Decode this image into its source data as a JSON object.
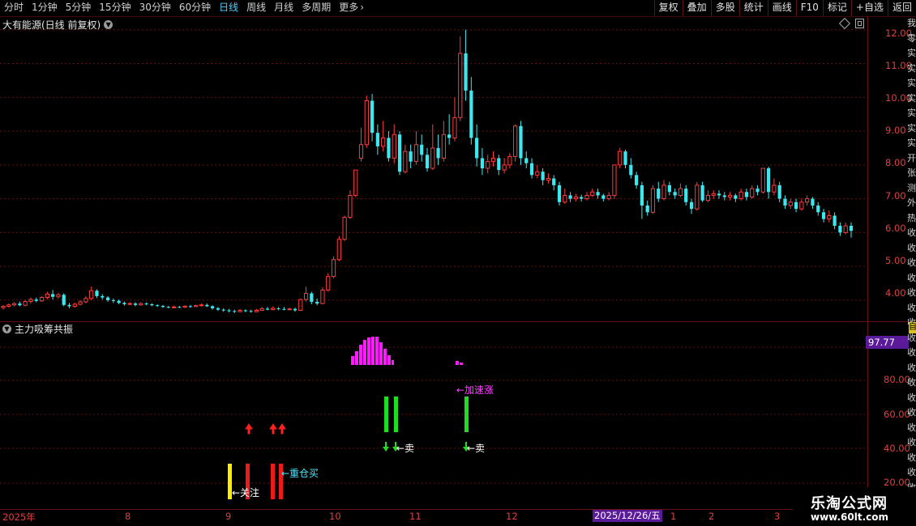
{
  "toolbar": {
    "periods": [
      "分时",
      "1分钟",
      "5分钟",
      "15分钟",
      "30分钟",
      "60分钟",
      "日线",
      "周线",
      "月线",
      "多周期",
      "更多"
    ],
    "active_period": "日线",
    "more_arrow": "›",
    "tools": [
      "复权",
      "叠加",
      "多股",
      "统计",
      "画线",
      "F10",
      "标记",
      "+自选",
      "返回"
    ]
  },
  "main_chart": {
    "title": "大有能源(日线 前复权)",
    "y_ticks": [
      "12.00",
      "11.00",
      "10.00",
      "9.00",
      "8.00",
      "7.00",
      "6.00",
      "5.00",
      "4.00"
    ]
  },
  "indicator": {
    "name": "主力吸筹共振",
    "value_badge": "97.77",
    "y_ticks": [
      "80.00",
      "60.00",
      "40.00",
      "20.00"
    ],
    "labels": {
      "watch": "←关注",
      "heavy_buy": "←重仓买",
      "sell1": "←卖",
      "sell2": "←卖",
      "accel": "←加速涨"
    }
  },
  "x_axis": {
    "labels": [
      "2025年",
      "8",
      "9",
      "10",
      "11",
      "12",
      "1",
      "2",
      "3"
    ],
    "cursor_date": "2025/12/26/五"
  },
  "right_strip": {
    "chars": [
      "我",
      "零",
      "实",
      "实",
      "实",
      "实",
      "实",
      "实",
      "实",
      "开",
      "张",
      "测",
      "外",
      "热",
      "收",
      "收",
      "收",
      "收",
      "收",
      "收",
      "收",
      "收",
      "收",
      "收",
      "收",
      "收",
      "收",
      "收",
      "收",
      "收",
      "收",
      "收"
    ],
    "badge": "自"
  },
  "watermark": {
    "line1": "乐淘公式网",
    "line2": "www.60lt.com"
  },
  "colors": {
    "up": "#ff3c3c",
    "down": "#3ce8f0",
    "grid": "#6a1010",
    "axis": "#e04040",
    "magenta": "#ff1aff",
    "green": "#20dd20",
    "yellow": "#ffee00"
  },
  "chart_data": {
    "type": "candlestick",
    "y_range": [
      3.4,
      12.4
    ],
    "indicator_y_range": [
      0,
      100
    ],
    "candles": [
      [
        3.78,
        3.82,
        3.72,
        3.85
      ],
      [
        3.82,
        3.86,
        3.78,
        3.9
      ],
      [
        3.86,
        3.9,
        3.82,
        3.94
      ],
      [
        3.9,
        3.85,
        3.82,
        3.96
      ],
      [
        3.85,
        3.96,
        3.82,
        4.0
      ],
      [
        3.96,
        4.02,
        3.9,
        4.08
      ],
      [
        4.02,
        3.98,
        3.94,
        4.08
      ],
      [
        3.98,
        4.08,
        3.95,
        4.12
      ],
      [
        4.08,
        4.18,
        4.02,
        4.25
      ],
      [
        4.18,
        4.1,
        4.02,
        4.3
      ],
      [
        4.1,
        4.16,
        4.05,
        4.22
      ],
      [
        4.16,
        3.86,
        3.82,
        4.2
      ],
      [
        3.86,
        3.82,
        3.76,
        3.92
      ],
      [
        3.82,
        3.88,
        3.78,
        3.93
      ],
      [
        3.88,
        3.95,
        3.84,
        4.0
      ],
      [
        3.95,
        4.05,
        3.9,
        4.12
      ],
      [
        4.05,
        4.28,
        4.0,
        4.4
      ],
      [
        4.28,
        4.12,
        4.06,
        4.32
      ],
      [
        4.12,
        4.08,
        4.02,
        4.18
      ],
      [
        4.08,
        4.0,
        3.95,
        4.12
      ],
      [
        4.0,
        3.98,
        3.92,
        4.05
      ],
      [
        3.98,
        3.92,
        3.88,
        4.02
      ],
      [
        3.92,
        3.88,
        3.84,
        3.96
      ],
      [
        3.88,
        3.9,
        3.85,
        3.94
      ],
      [
        3.9,
        3.86,
        3.82,
        3.94
      ],
      [
        3.86,
        3.9,
        3.84,
        3.94
      ],
      [
        3.9,
        3.88,
        3.85,
        3.93
      ],
      [
        3.88,
        3.85,
        3.82,
        3.91
      ],
      [
        3.85,
        3.83,
        3.8,
        3.88
      ],
      [
        3.83,
        3.8,
        3.77,
        3.86
      ],
      [
        3.8,
        3.78,
        3.76,
        3.83
      ],
      [
        3.78,
        3.8,
        3.76,
        3.84
      ],
      [
        3.8,
        3.79,
        3.77,
        3.83
      ],
      [
        3.79,
        3.82,
        3.77,
        3.85
      ],
      [
        3.82,
        3.81,
        3.78,
        3.86
      ],
      [
        3.81,
        3.84,
        3.8,
        3.87
      ],
      [
        3.84,
        3.86,
        3.82,
        3.9
      ],
      [
        3.86,
        3.82,
        3.8,
        3.9
      ],
      [
        3.82,
        3.76,
        3.72,
        3.85
      ],
      [
        3.76,
        3.72,
        3.68,
        3.8
      ],
      [
        3.72,
        3.7,
        3.66,
        3.76
      ],
      [
        3.7,
        3.68,
        3.64,
        3.74
      ],
      [
        3.68,
        3.66,
        3.62,
        3.72
      ],
      [
        3.66,
        3.7,
        3.64,
        3.74
      ],
      [
        3.7,
        3.68,
        3.64,
        3.73
      ],
      [
        3.68,
        3.66,
        3.63,
        3.72
      ],
      [
        3.66,
        3.7,
        3.64,
        3.74
      ],
      [
        3.7,
        3.75,
        3.68,
        3.8
      ],
      [
        3.75,
        3.72,
        3.7,
        3.8
      ],
      [
        3.72,
        3.76,
        3.7,
        3.82
      ],
      [
        3.76,
        3.74,
        3.7,
        3.8
      ],
      [
        3.74,
        3.72,
        3.7,
        3.8
      ],
      [
        3.72,
        3.74,
        3.7,
        3.78
      ],
      [
        3.74,
        3.7,
        3.66,
        3.78
      ],
      [
        3.7,
        4.02,
        3.68,
        4.05
      ],
      [
        4.02,
        4.2,
        3.96,
        4.4
      ],
      [
        4.2,
        3.95,
        3.88,
        4.25
      ],
      [
        3.95,
        3.9,
        3.85,
        4.05
      ],
      [
        3.9,
        4.3,
        3.88,
        4.38
      ],
      [
        4.3,
        4.7,
        4.25,
        4.8
      ],
      [
        4.7,
        5.2,
        4.65,
        5.3
      ],
      [
        5.2,
        5.8,
        5.15,
        5.9
      ],
      [
        5.8,
        6.45,
        5.75,
        6.5
      ],
      [
        6.45,
        7.1,
        6.4,
        7.25
      ],
      [
        7.1,
        7.85,
        7.05,
        7.85
      ],
      [
        8.2,
        8.6,
        8.1,
        9.1
      ],
      [
        8.6,
        9.9,
        8.5,
        10.05
      ],
      [
        9.9,
        8.95,
        8.7,
        10.1
      ],
      [
        8.95,
        8.55,
        8.3,
        9.2
      ],
      [
        8.55,
        8.8,
        8.4,
        9.3
      ],
      [
        8.8,
        8.2,
        8.1,
        9.0
      ],
      [
        8.2,
        8.9,
        8.05,
        9.2
      ],
      [
        8.9,
        7.8,
        7.7,
        9.0
      ],
      [
        7.8,
        8.4,
        7.75,
        8.6
      ],
      [
        8.4,
        8.1,
        7.9,
        8.6
      ],
      [
        8.1,
        8.6,
        8.0,
        9.0
      ],
      [
        8.6,
        8.3,
        8.1,
        8.9
      ],
      [
        8.3,
        7.9,
        7.8,
        8.5
      ],
      [
        7.9,
        8.5,
        7.85,
        9.2
      ],
      [
        8.5,
        8.2,
        8.0,
        8.9
      ],
      [
        8.2,
        8.9,
        8.1,
        9.3
      ],
      [
        8.9,
        8.8,
        8.6,
        9.5
      ],
      [
        8.8,
        9.4,
        8.7,
        10.0
      ],
      [
        9.4,
        11.3,
        9.3,
        11.8
      ],
      [
        11.3,
        10.2,
        9.9,
        12.0
      ],
      [
        10.2,
        8.8,
        8.6,
        10.6
      ],
      [
        8.8,
        8.2,
        7.95,
        9.2
      ],
      [
        8.2,
        7.9,
        7.7,
        8.5
      ],
      [
        7.9,
        8.1,
        7.75,
        8.3
      ],
      [
        8.1,
        8.2,
        7.95,
        8.4
      ],
      [
        8.2,
        7.85,
        7.7,
        8.3
      ],
      [
        7.85,
        8.0,
        7.75,
        8.2
      ],
      [
        8.0,
        8.25,
        7.9,
        8.35
      ],
      [
        8.25,
        9.15,
        8.1,
        9.2
      ],
      [
        9.15,
        8.2,
        8.0,
        9.3
      ],
      [
        8.2,
        8.05,
        7.9,
        8.4
      ],
      [
        8.05,
        7.7,
        7.6,
        8.2
      ],
      [
        7.7,
        7.8,
        7.6,
        8.0
      ],
      [
        7.8,
        7.55,
        7.4,
        7.9
      ],
      [
        7.55,
        7.6,
        7.45,
        7.75
      ],
      [
        7.6,
        7.4,
        7.25,
        7.7
      ],
      [
        7.4,
        6.9,
        6.8,
        7.5
      ],
      [
        6.9,
        7.1,
        6.85,
        7.3
      ],
      [
        7.1,
        7.0,
        6.9,
        7.2
      ],
      [
        7.0,
        7.05,
        6.92,
        7.15
      ],
      [
        7.05,
        7.0,
        6.92,
        7.12
      ],
      [
        7.0,
        7.1,
        6.95,
        7.2
      ],
      [
        7.1,
        7.2,
        7.05,
        7.3
      ],
      [
        7.2,
        7.1,
        7.0,
        7.3
      ],
      [
        7.1,
        7.0,
        6.92,
        7.15
      ],
      [
        7.0,
        7.1,
        6.95,
        7.2
      ],
      [
        7.1,
        8.0,
        7.0,
        8.0
      ],
      [
        8.0,
        8.4,
        7.9,
        8.5
      ],
      [
        8.4,
        8.0,
        7.9,
        8.45
      ],
      [
        8.0,
        7.7,
        7.6,
        8.2
      ],
      [
        7.7,
        7.4,
        7.3,
        7.8
      ],
      [
        7.4,
        6.8,
        6.4,
        7.5
      ],
      [
        6.8,
        6.6,
        6.5,
        6.95
      ],
      [
        6.6,
        7.3,
        6.55,
        7.4
      ],
      [
        7.3,
        7.0,
        6.9,
        7.5
      ],
      [
        7.0,
        7.4,
        6.95,
        7.55
      ],
      [
        7.4,
        7.2,
        7.1,
        7.5
      ],
      [
        7.2,
        7.1,
        7.0,
        7.3
      ],
      [
        7.1,
        7.3,
        7.05,
        7.45
      ],
      [
        7.3,
        6.9,
        6.8,
        7.4
      ],
      [
        6.9,
        6.7,
        6.55,
        7.0
      ],
      [
        6.7,
        7.4,
        6.65,
        7.5
      ],
      [
        7.4,
        6.95,
        6.9,
        7.5
      ],
      [
        6.95,
        7.1,
        6.9,
        7.25
      ],
      [
        7.1,
        7.15,
        7.0,
        7.25
      ],
      [
        7.15,
        7.1,
        7.0,
        7.25
      ],
      [
        7.1,
        7.05,
        6.95,
        7.2
      ],
      [
        7.05,
        7.1,
        6.95,
        7.2
      ],
      [
        7.1,
        7.0,
        6.9,
        7.15
      ],
      [
        7.0,
        7.2,
        6.95,
        7.3
      ],
      [
        7.2,
        7.05,
        6.95,
        7.3
      ],
      [
        7.05,
        7.3,
        7.0,
        7.4
      ],
      [
        7.3,
        7.2,
        7.1,
        7.4
      ],
      [
        7.2,
        7.9,
        7.15,
        7.9
      ],
      [
        7.9,
        7.2,
        7.0,
        7.95
      ],
      [
        7.2,
        7.4,
        7.1,
        7.6
      ],
      [
        7.4,
        7.0,
        6.9,
        7.5
      ],
      [
        7.0,
        6.8,
        6.7,
        7.1
      ],
      [
        6.8,
        6.9,
        6.7,
        7.0
      ],
      [
        6.9,
        6.7,
        6.6,
        7.0
      ],
      [
        6.7,
        6.9,
        6.65,
        7.0
      ],
      [
        6.9,
        7.0,
        6.8,
        7.1
      ],
      [
        7.0,
        6.8,
        6.7,
        7.05
      ],
      [
        6.8,
        6.6,
        6.5,
        6.9
      ],
      [
        6.6,
        6.4,
        6.3,
        6.7
      ],
      [
        6.4,
        6.5,
        6.3,
        6.65
      ],
      [
        6.5,
        6.2,
        6.1,
        6.6
      ],
      [
        6.2,
        6.0,
        5.9,
        6.3
      ],
      [
        6.0,
        6.2,
        5.95,
        6.3
      ],
      [
        6.2,
        6.05,
        5.85,
        6.3
      ]
    ]
  }
}
